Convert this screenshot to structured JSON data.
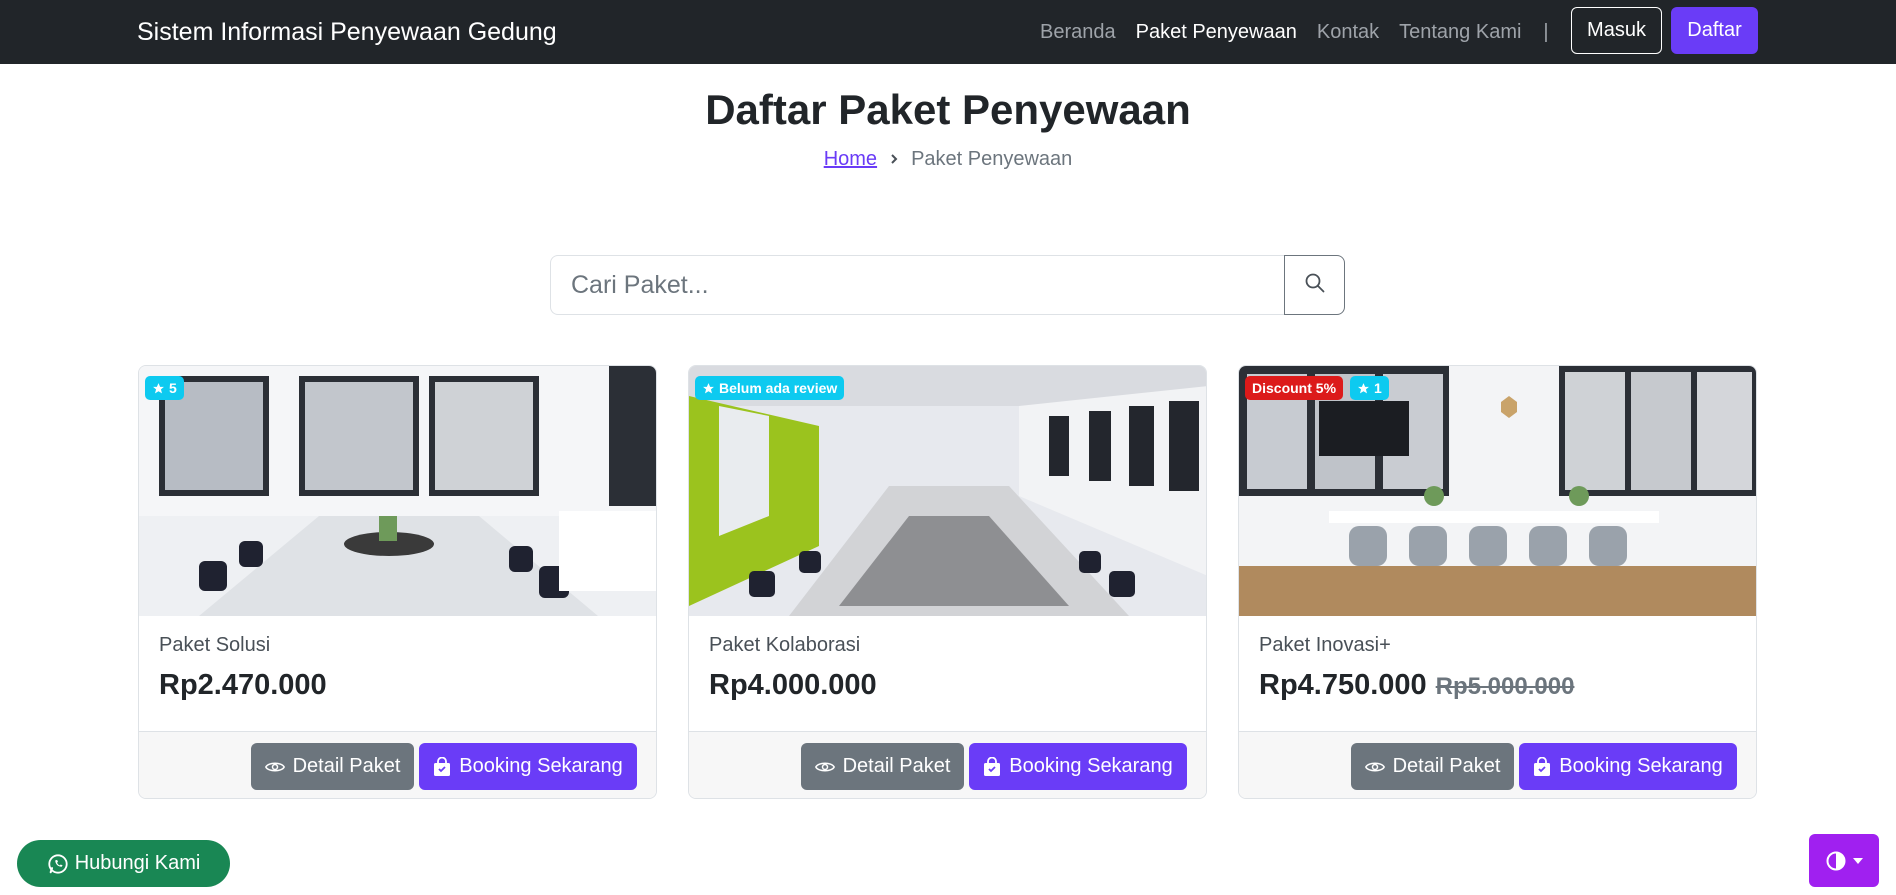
{
  "navbar": {
    "brand": "Sistem Informasi Penyewaan Gedung",
    "links": [
      "Beranda",
      "Paket Penyewaan",
      "Kontak",
      "Tentang Kami"
    ],
    "active_link": "Paket Penyewaan",
    "separator": "|",
    "login_label": "Masuk",
    "register_label": "Daftar"
  },
  "header": {
    "title": "Daftar Paket Penyewaan",
    "breadcrumb": [
      "Home",
      "Paket Penyewaan"
    ]
  },
  "search": {
    "placeholder": "Cari Paket...",
    "icon": "search-icon"
  },
  "packages": [
    {
      "name": "Paket Solusi",
      "price": "Rp2.470.000",
      "old_price": "",
      "badges": [
        {
          "type": "rating",
          "text": "5",
          "color": "#0dcaf0"
        }
      ],
      "detail_label": "Detail Paket",
      "book_label": "Booking Sekarang"
    },
    {
      "name": "Paket Kolaborasi",
      "price": "Rp4.000.000",
      "old_price": "",
      "badges": [
        {
          "type": "rating",
          "text": "Belum ada review",
          "color": "#0dcaf0"
        }
      ],
      "detail_label": "Detail Paket",
      "book_label": "Booking Sekarang"
    },
    {
      "name": "Paket Inovasi+",
      "price": "Rp4.750.000",
      "old_price": "Rp5.000.000",
      "badges": [
        {
          "type": "discount",
          "text": "Discount 5%",
          "color": "#dc1a1a"
        },
        {
          "type": "rating",
          "text": "1",
          "color": "#0dcaf0"
        }
      ],
      "detail_label": "Detail Paket",
      "book_label": "Booking Sekarang"
    }
  ],
  "floating": {
    "whatsapp_label": "Hubungi Kami",
    "theme_toggle_icon": "contrast-icon"
  },
  "colors": {
    "primary": "#6a3cf7",
    "navbar_bg": "#212529",
    "secondary": "#6c757d",
    "info": "#0dcaf0",
    "danger": "#dc1a1a",
    "success": "#198754",
    "theme_toggle": "#a020f0"
  }
}
